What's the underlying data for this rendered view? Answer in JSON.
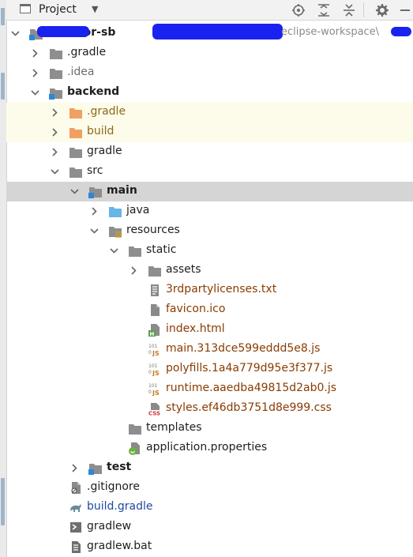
{
  "header": {
    "title": "Project",
    "icons": [
      "project-view-icon",
      "dropdown-caret-icon",
      "locate-icon",
      "expand-all-icon",
      "collapse-all-icon",
      "settings-gear-icon",
      "hide-panel-icon"
    ]
  },
  "tree": [
    {
      "id": "root",
      "depth": 0,
      "expanded": true,
      "icon": "module-folder",
      "label": "monitor-sb",
      "path": "eclipse-workspace\\",
      "bold": true
    },
    {
      "id": "gradle-root",
      "depth": 1,
      "expanded": false,
      "icon": "folder",
      "label": ".gradle"
    },
    {
      "id": "idea",
      "depth": 1,
      "expanded": false,
      "icon": "folder",
      "label": ".idea",
      "style": "mod"
    },
    {
      "id": "backend",
      "depth": 1,
      "expanded": true,
      "icon": "module-folder",
      "label": "backend",
      "bold": true
    },
    {
      "id": "backend-gradle-hidden",
      "depth": 2,
      "expanded": false,
      "icon": "excluded-folder",
      "label": ".gradle",
      "style": "excl",
      "highlight": "yellow"
    },
    {
      "id": "build",
      "depth": 2,
      "expanded": false,
      "icon": "excluded-folder",
      "label": "build",
      "style": "excl",
      "highlight": "yellow"
    },
    {
      "id": "gradle",
      "depth": 2,
      "expanded": false,
      "icon": "folder",
      "label": "gradle"
    },
    {
      "id": "src",
      "depth": 2,
      "expanded": true,
      "icon": "folder",
      "label": "src"
    },
    {
      "id": "main",
      "depth": 3,
      "expanded": true,
      "icon": "module-folder",
      "label": "main",
      "bold": true,
      "highlight": "gray"
    },
    {
      "id": "java",
      "depth": 4,
      "expanded": false,
      "icon": "source-folder",
      "label": "java"
    },
    {
      "id": "resources",
      "depth": 4,
      "expanded": true,
      "icon": "resources-folder",
      "label": "resources"
    },
    {
      "id": "static",
      "depth": 5,
      "expanded": true,
      "icon": "folder",
      "label": "static"
    },
    {
      "id": "assets",
      "depth": 6,
      "expanded": false,
      "icon": "folder",
      "label": "assets"
    },
    {
      "id": "licenses",
      "depth": 6,
      "icon": "text-file",
      "label": "3rdpartylicenses.txt",
      "style": "res"
    },
    {
      "id": "favicon",
      "depth": 6,
      "icon": "generic-file",
      "label": "favicon.ico",
      "style": "res"
    },
    {
      "id": "index",
      "depth": 6,
      "icon": "html-file",
      "label": "index.html",
      "style": "res"
    },
    {
      "id": "mainjs",
      "depth": 6,
      "icon": "js-file",
      "label": "main.313dce599eddd5e8.js",
      "style": "res"
    },
    {
      "id": "polyfills",
      "depth": 6,
      "icon": "js-file",
      "label": "polyfills.1a4a779d95e3f377.js",
      "style": "res"
    },
    {
      "id": "runtime",
      "depth": 6,
      "icon": "js-file",
      "label": "runtime.aaedba49815d2ab0.js",
      "style": "res"
    },
    {
      "id": "styles",
      "depth": 6,
      "icon": "css-file",
      "label": "styles.ef46db3751d8e999.css",
      "style": "res"
    },
    {
      "id": "templates",
      "depth": 5,
      "icon": "folder",
      "label": "templates"
    },
    {
      "id": "appprops",
      "depth": 5,
      "icon": "spring-properties-file",
      "label": "application.properties"
    },
    {
      "id": "test",
      "depth": 3,
      "expanded": false,
      "icon": "module-folder",
      "label": "test",
      "bold": true
    },
    {
      "id": "gitignore",
      "depth": 2,
      "icon": "gitignore-file",
      "label": ".gitignore"
    },
    {
      "id": "buildgradle",
      "depth": 2,
      "icon": "gradle-file",
      "label": "build.gradle",
      "style": "blue"
    },
    {
      "id": "gradlew",
      "depth": 2,
      "icon": "shell-file",
      "label": "gradlew"
    },
    {
      "id": "gradlewbat",
      "depth": 2,
      "icon": "bat-file",
      "label": "gradlew.bat"
    }
  ]
}
